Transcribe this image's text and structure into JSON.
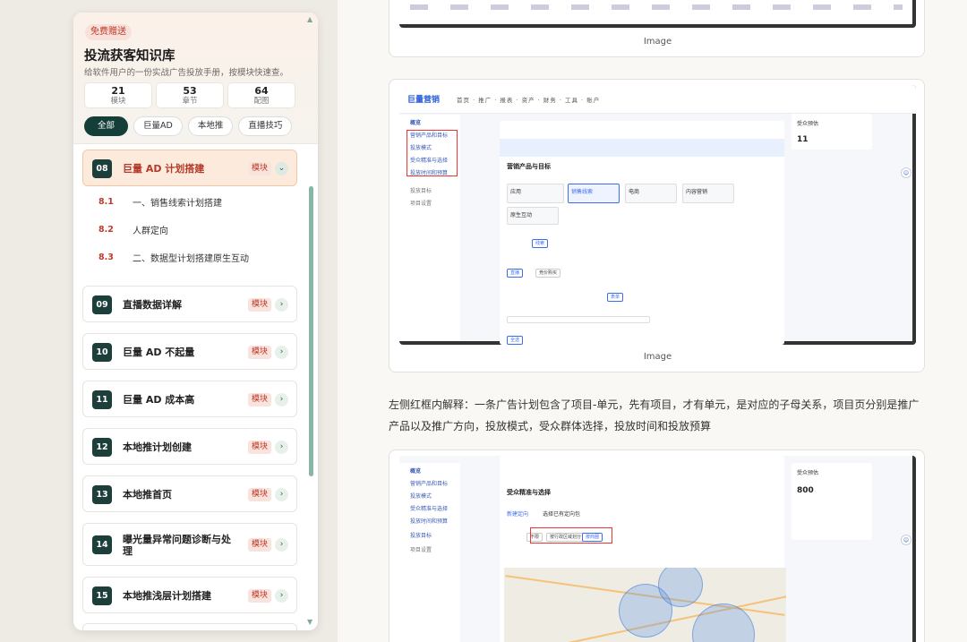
{
  "sidebar": {
    "badge": "免费赠送",
    "title": "投流获客知识库",
    "subtitle": "给软件用户的一份实战广告投放手册，按模块快速查。",
    "stats": [
      {
        "num": "21",
        "label": "模块"
      },
      {
        "num": "53",
        "label": "章节"
      },
      {
        "num": "64",
        "label": "配图"
      }
    ],
    "filters": [
      "全部",
      "巨量AD",
      "本地推",
      "直播技巧"
    ],
    "active_filter": "全部",
    "tag_label": "模块",
    "active_module": {
      "num": "08",
      "title": "巨量 AD 计划搭建"
    },
    "sub_items": [
      {
        "num": "8.1",
        "title": "一、销售线索计划搭建"
      },
      {
        "num": "8.2",
        "title": "人群定向"
      },
      {
        "num": "8.3",
        "title": "二、数据型计划搭建原生互动"
      }
    ],
    "modules": [
      {
        "num": "09",
        "title": "直播数据详解"
      },
      {
        "num": "10",
        "title": "巨量 AD 不起量"
      },
      {
        "num": "11",
        "title": "巨量 AD 成本高"
      },
      {
        "num": "12",
        "title": "本地推计划创建"
      },
      {
        "num": "13",
        "title": "本地推首页"
      },
      {
        "num": "14",
        "title": "曝光量异常问题诊断与处理"
      },
      {
        "num": "15",
        "title": "本地推浅层计划搭建"
      }
    ]
  },
  "content": {
    "caption1": "Image",
    "caption2": "Image",
    "paragraph": "左侧红框内解释：一条广告计划包含了项目-单元，先有项目，才有单元，是对应的子母关系，项目页分别是推广产品以及推广方向，投放模式，受众群体选择，投放时间和投放预算",
    "shot2": {
      "logo": "巨量营销",
      "nav": "首页 · 推广 · 报表 · 资产 · 财务 · 工具 · 账户",
      "panel_title": "营销产品与目标",
      "side_items": [
        "概览",
        "营销产品和目标",
        "投放模式",
        "受众精准与选择",
        "投放时间和预算",
        "投放目标",
        "项目设置"
      ],
      "right_title": "受众预估",
      "right_num": "11",
      "options": [
        "应用",
        "销售线索",
        "电商",
        "内容营销",
        "原生互动"
      ],
      "pills": [
        "线索",
        "直播",
        "竞价购买",
        "表单",
        "全选"
      ]
    },
    "shot3": {
      "panel_title": "受众精准与选择",
      "side_items": [
        "概览",
        "营销产品和目标",
        "投放模式",
        "受众精准与选择",
        "投放时间和预算",
        "投放目标",
        "项目设置"
      ],
      "tabs": [
        "新建定向",
        "选择已有定向包"
      ],
      "pills": [
        "不限",
        "按行政区域划分",
        "按商圈"
      ],
      "right_title": "受众预估",
      "right_num": "800"
    }
  }
}
